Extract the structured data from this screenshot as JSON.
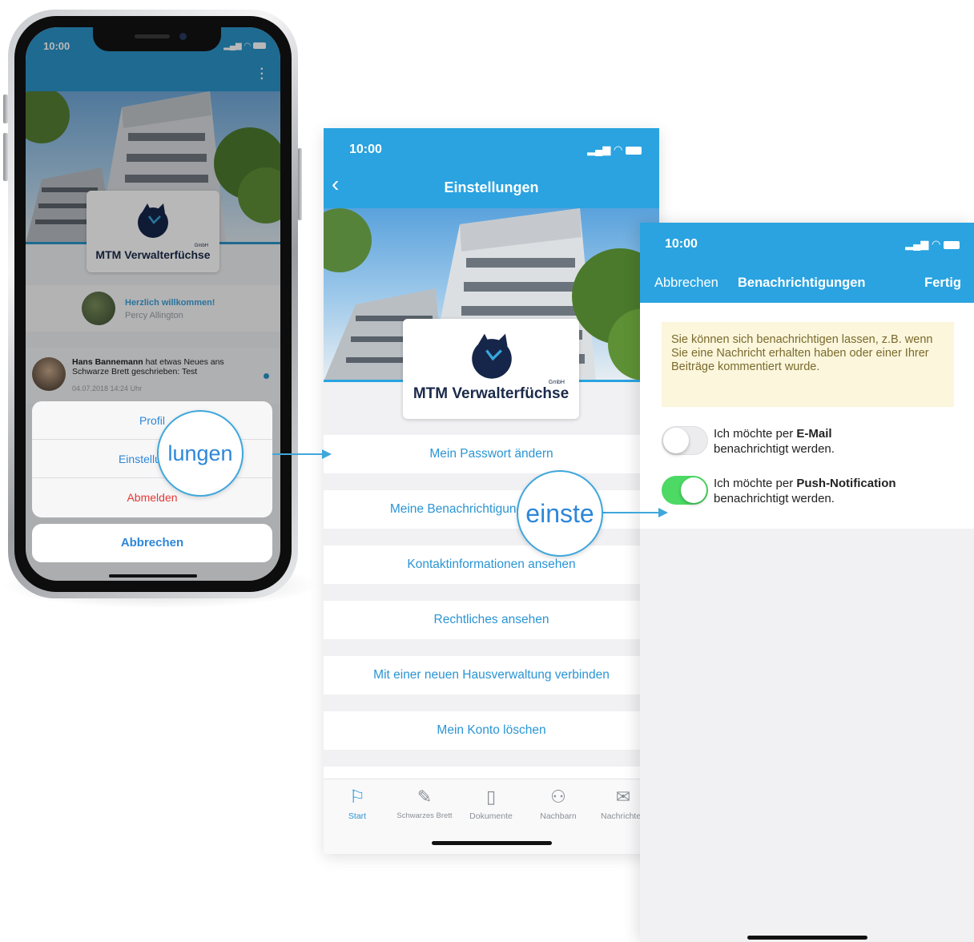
{
  "phone1": {
    "time": "10:00",
    "logo": {
      "name": "MTM Verwalterfüchse",
      "suffix": "GmbH"
    },
    "welcome": {
      "title": "Herzlich willkommen!",
      "name": "Percy Allington"
    },
    "feed": {
      "author": "Hans Bannemann",
      "text": " hat etwas Neues ans Schwarze Brett geschrieben: Test",
      "date": "04.07.2018 14:24 Uhr"
    },
    "action_sheet": {
      "options": [
        "Profil",
        "Einstellungen",
        "Abmelden"
      ],
      "cancel": "Abbrechen"
    },
    "colors": {
      "header": "#2a93c9",
      "destructive": "#e53935",
      "link": "#2d87d8"
    }
  },
  "magnifiers": {
    "bubble1_text": "lungen",
    "bubble2_text": "einste"
  },
  "screen2": {
    "time": "10:00",
    "title": "Einstellungen",
    "logo": {
      "name": "MTM Verwalterfüchse",
      "suffix": "GmbH"
    },
    "menu": [
      "Mein Passwort ändern",
      "Meine Benachrichtigungen einstellen",
      "Kontaktinformationen ansehen",
      "Rechtliches ansehen",
      "Mit einer neuen Hausverwaltung verbinden",
      "Mein Konto löschen"
    ],
    "tabs": [
      {
        "label": "Start",
        "icon": "flag-icon",
        "active": true
      },
      {
        "label": "Schwarzes Brett",
        "icon": "pin-icon",
        "active": false
      },
      {
        "label": "Dokumente",
        "icon": "document-icon",
        "active": false
      },
      {
        "label": "Nachbarn",
        "icon": "people-icon",
        "active": false
      },
      {
        "label": "Nachrichten",
        "icon": "envelope-icon",
        "active": false
      }
    ],
    "colors": {
      "header": "#2aa3e0",
      "accent": "#2a95d4"
    }
  },
  "screen3": {
    "time": "10:00",
    "cancel": "Abbrechen",
    "title": "Benachrichtigungen",
    "done": "Fertig",
    "info": "Sie können sich benachrichtigen lassen, z.B. wenn Sie eine Nachricht erhalten haben oder einer Ihrer Beiträge kommentiert wurde.",
    "options": [
      {
        "prefix": "Ich möchte per ",
        "channel": "E-Mail",
        "suffix": "benachrichtigt werden.",
        "enabled": false
      },
      {
        "prefix": "Ich möchte per ",
        "channel": "Push-Notification",
        "suffix": "benachrichtigt werden.",
        "enabled": true
      }
    ],
    "colors": {
      "header": "#2aa3e0",
      "info_bg": "#fbf6dc",
      "toggle_on": "#4cd964"
    }
  }
}
